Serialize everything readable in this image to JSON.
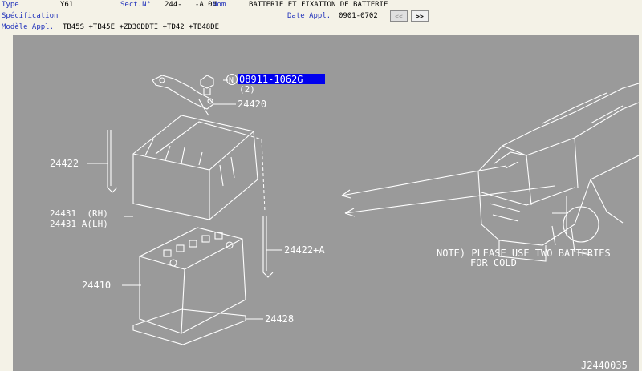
{
  "header": {
    "type_label": "Type",
    "type_value": "Y61",
    "sect_label": "Sect.N°",
    "sect_value": "244-   -A 04",
    "nom_label": "Nom",
    "nom_value": "BATTERIE ET FIXATION DE BATTERIE",
    "spec_label": "Spécification",
    "date_label": "Date Appl.",
    "date_value": "0901-0702",
    "modele_label": "Modèle Appl.",
    "modele_value": "TB45S +TB45E +ZD30DDTI +TD42 +TB48DE",
    "prev_label": "<<",
    "next_label": ">>"
  },
  "diagram": {
    "selected_part": "08911-1062G",
    "selected_qty": "(2)",
    "n_marker": "N",
    "labels": {
      "p24420": "24420",
      "p24422": "24422",
      "p24431": "24431  (RH)",
      "p24431a": "24431+A(LH)",
      "p24422a": "24422+A",
      "p24410": "24410",
      "p24428": "24428"
    },
    "note_line1": "NOTE) PLEASE USE TWO BATTERIES",
    "note_line2": "FOR COLD",
    "drawing_code": "J2440035"
  }
}
